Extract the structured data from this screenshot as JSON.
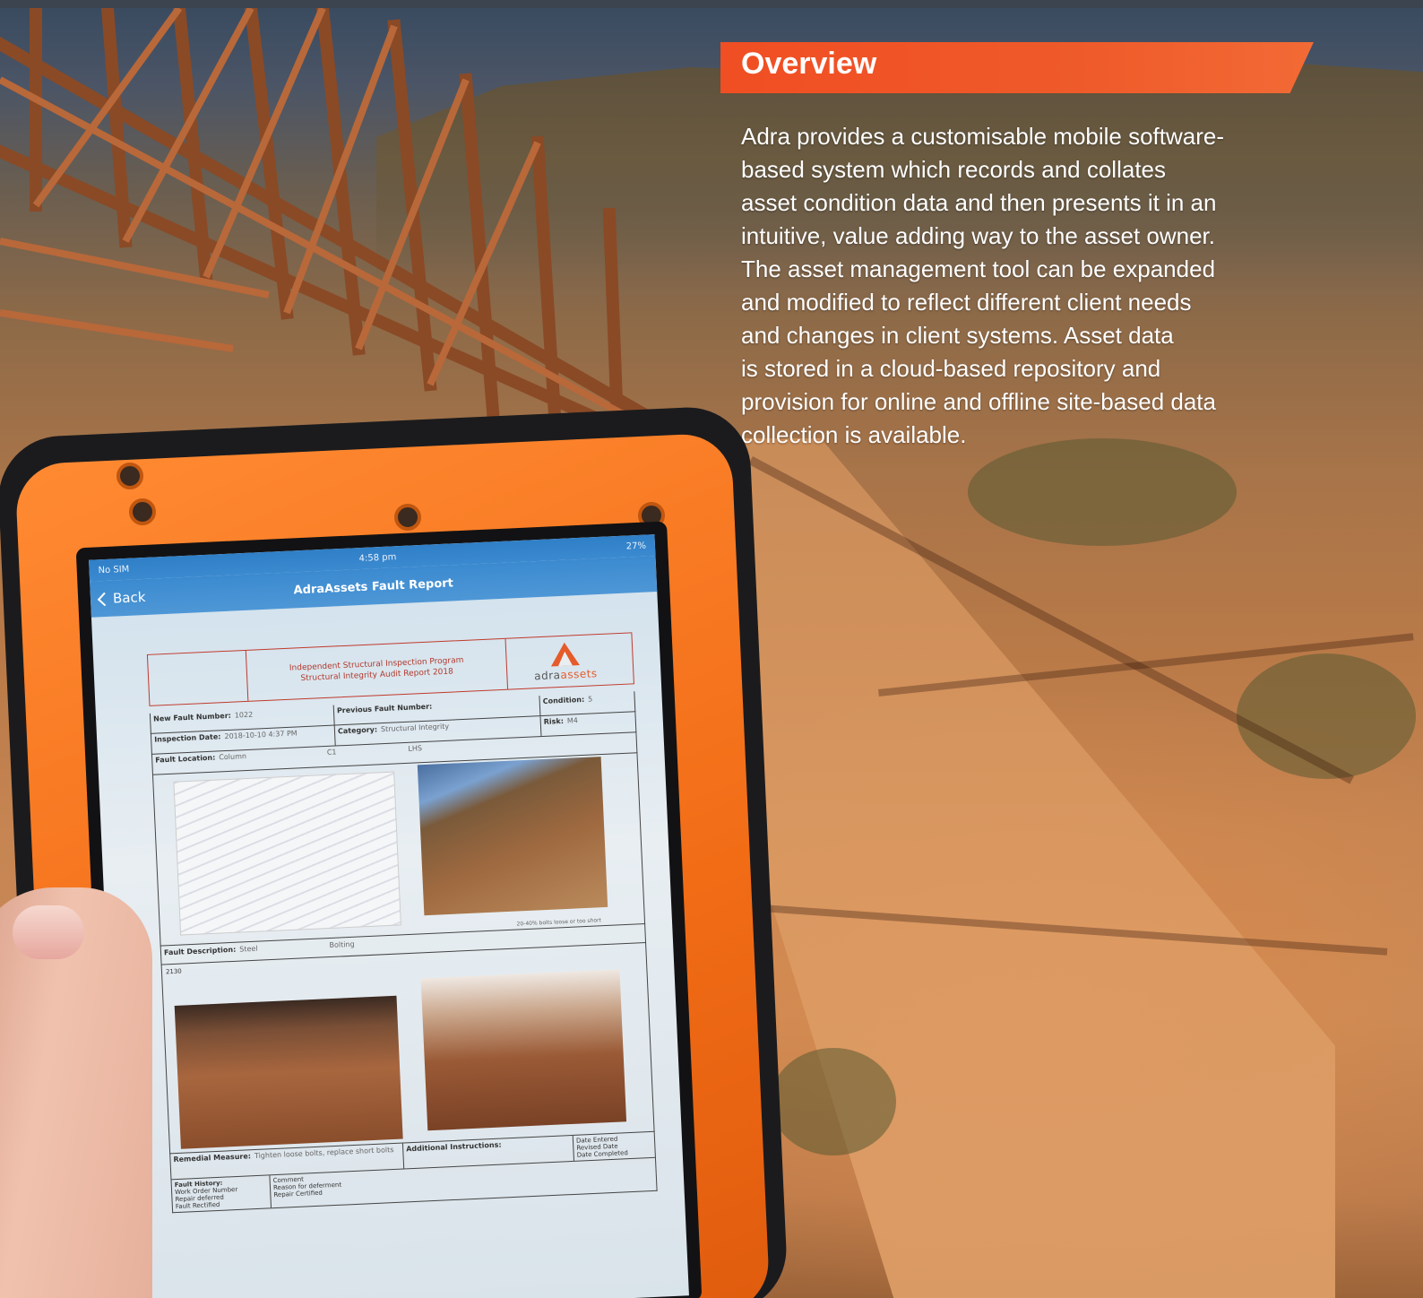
{
  "overview": {
    "title": "Overview",
    "body": "Adra provides a customisable mobile software-\nbased system which records and collates\nasset condition data and then presents it in an\nintuitive, value adding way to the asset owner.\nThe asset management tool can be expanded\nand modified to reflect different client needs\nand changes in client systems.  Asset data\nis stored in a cloud-based repository and\nprovision for online and offline site-based data\ncollection is available."
  },
  "tablet": {
    "status": {
      "carrier": "No SIM",
      "time": "4:58 pm",
      "battery": "27%"
    },
    "nav": {
      "back_label": "Back",
      "title": "AdraAssets Fault Report"
    },
    "report": {
      "program_line1": "Independent Structural Inspection Program",
      "program_line2": "Structural Integrity Audit Report 2018",
      "logo_a": "adra",
      "logo_b": "assets",
      "new_fault_label": "New Fault Number:",
      "new_fault_value": "1022",
      "prev_fault_label": "Previous Fault Number:",
      "condition_label": "Condition:",
      "condition_value": "5",
      "inspection_date_label": "Inspection Date:",
      "inspection_date_value": "2018-10-10 4:37 PM",
      "category_label": "Category:",
      "category_value": "Structural Integrity",
      "risk_label": "Risk:",
      "risk_value": "M4",
      "fault_location_label": "Fault Location:",
      "fault_location_value": "Column",
      "fault_location_c1": "C1",
      "fault_location_side": "LHS",
      "photo_caption": "20-40% bolts loose or too short",
      "fault_desc_label": "Fault Description:",
      "fault_desc_value": "Steel",
      "fault_desc_type": "Bolting",
      "drawing_no": "2130",
      "remedial_label": "Remedial Measure:",
      "remedial_value": "Tighten loose bolts, replace short bolts",
      "additional_label": "Additional Instructions:",
      "date_entered": "Date Entered",
      "revised_date": "Revised Date",
      "date_completed": "Date Completed",
      "fault_history_label": "Fault History:",
      "work_order": "Work Order Number",
      "comment": "Comment",
      "repair_deferred": "Repair deferred",
      "reason_deferment": "Reason for deferment",
      "rectified": "Fault Rectified",
      "repair_certified": "Repair Certified"
    }
  },
  "colors": {
    "accent": "#f04e23",
    "tablet_case": "#f26c16",
    "ios_blue": "#3b8ad0"
  }
}
